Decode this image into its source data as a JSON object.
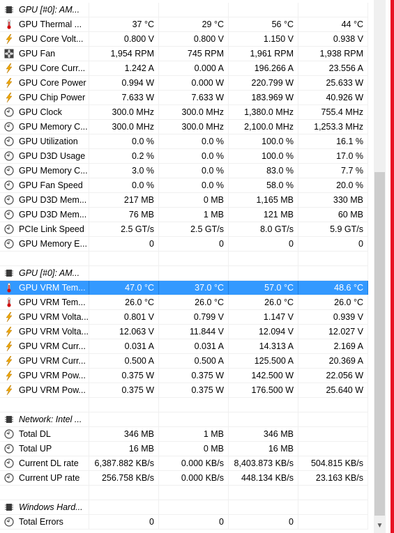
{
  "colors": {
    "selected_row": "#3399ff",
    "accent_red": "#e81123"
  },
  "rows": [
    {
      "kind": "header",
      "icon": "chip-icon",
      "label": "GPU [#0]: AM...",
      "v": [
        "",
        "",
        "",
        ""
      ]
    },
    {
      "kind": "data",
      "icon": "thermometer-icon",
      "label": "GPU Thermal ...",
      "v": [
        "37 °C",
        "29 °C",
        "56 °C",
        "44 °C"
      ]
    },
    {
      "kind": "data",
      "icon": "lightning-icon",
      "label": "GPU Core Volt...",
      "v": [
        "0.800 V",
        "0.800 V",
        "1.150 V",
        "0.938 V"
      ]
    },
    {
      "kind": "data",
      "icon": "fan-icon",
      "label": "GPU Fan",
      "v": [
        "1,954 RPM",
        "745 RPM",
        "1,961 RPM",
        "1,938 RPM"
      ]
    },
    {
      "kind": "data",
      "icon": "lightning-icon",
      "label": "GPU Core Curr...",
      "v": [
        "1.242 A",
        "0.000 A",
        "196.266 A",
        "23.556 A"
      ]
    },
    {
      "kind": "data",
      "icon": "lightning-icon",
      "label": "GPU Core Power",
      "v": [
        "0.994 W",
        "0.000 W",
        "220.799 W",
        "25.633 W"
      ]
    },
    {
      "kind": "data",
      "icon": "lightning-icon",
      "label": "GPU Chip Power",
      "v": [
        "7.633 W",
        "7.633 W",
        "183.969 W",
        "40.926 W"
      ]
    },
    {
      "kind": "data",
      "icon": "clock-icon",
      "label": "GPU Clock",
      "v": [
        "300.0 MHz",
        "300.0 MHz",
        "1,380.0 MHz",
        "755.4 MHz"
      ]
    },
    {
      "kind": "data",
      "icon": "clock-icon",
      "label": "GPU Memory C...",
      "v": [
        "300.0 MHz",
        "300.0 MHz",
        "2,100.0 MHz",
        "1,253.3 MHz"
      ]
    },
    {
      "kind": "data",
      "icon": "clock-icon",
      "label": "GPU Utilization",
      "v": [
        "0.0 %",
        "0.0 %",
        "100.0 %",
        "16.1 %"
      ]
    },
    {
      "kind": "data",
      "icon": "clock-icon",
      "label": "GPU D3D Usage",
      "v": [
        "0.2 %",
        "0.0 %",
        "100.0 %",
        "17.0 %"
      ]
    },
    {
      "kind": "data",
      "icon": "clock-icon",
      "label": "GPU Memory C...",
      "v": [
        "3.0 %",
        "0.0 %",
        "83.0 %",
        "7.7 %"
      ]
    },
    {
      "kind": "data",
      "icon": "clock-icon",
      "label": "GPU Fan Speed",
      "v": [
        "0.0 %",
        "0.0 %",
        "58.0 %",
        "20.0 %"
      ]
    },
    {
      "kind": "data",
      "icon": "clock-icon",
      "label": "GPU D3D Mem...",
      "v": [
        "217 MB",
        "0 MB",
        "1,165 MB",
        "330 MB"
      ]
    },
    {
      "kind": "data",
      "icon": "clock-icon",
      "label": "GPU D3D Mem...",
      "v": [
        "76 MB",
        "1 MB",
        "121 MB",
        "60 MB"
      ]
    },
    {
      "kind": "data",
      "icon": "clock-icon",
      "label": "PCIe Link Speed",
      "v": [
        "2.5 GT/s",
        "2.5 GT/s",
        "8.0 GT/s",
        "5.9 GT/s"
      ]
    },
    {
      "kind": "data",
      "icon": "clock-icon",
      "label": "GPU Memory E...",
      "v": [
        "0",
        "0",
        "0",
        "0"
      ]
    },
    {
      "kind": "blank",
      "icon": "",
      "label": "",
      "v": [
        "",
        "",
        "",
        ""
      ]
    },
    {
      "kind": "header",
      "icon": "chip-icon",
      "label": "GPU [#0]: AM...",
      "v": [
        "",
        "",
        "",
        ""
      ]
    },
    {
      "kind": "data",
      "icon": "thermometer-icon",
      "label": "GPU VRM Tem...",
      "v": [
        "47.0 °C",
        "37.0 °C",
        "57.0 °C",
        "48.6 °C"
      ],
      "selected": true
    },
    {
      "kind": "data",
      "icon": "thermometer-icon",
      "label": "GPU VRM Tem...",
      "v": [
        "26.0 °C",
        "26.0 °C",
        "26.0 °C",
        "26.0 °C"
      ]
    },
    {
      "kind": "data",
      "icon": "lightning-icon",
      "label": "GPU VRM Volta...",
      "v": [
        "0.801 V",
        "0.799 V",
        "1.147 V",
        "0.939 V"
      ]
    },
    {
      "kind": "data",
      "icon": "lightning-icon",
      "label": "GPU VRM Volta...",
      "v": [
        "12.063 V",
        "11.844 V",
        "12.094 V",
        "12.027 V"
      ]
    },
    {
      "kind": "data",
      "icon": "lightning-icon",
      "label": "GPU VRM Curr...",
      "v": [
        "0.031 A",
        "0.031 A",
        "14.313 A",
        "2.169 A"
      ]
    },
    {
      "kind": "data",
      "icon": "lightning-icon",
      "label": "GPU VRM Curr...",
      "v": [
        "0.500 A",
        "0.500 A",
        "125.500 A",
        "20.369 A"
      ]
    },
    {
      "kind": "data",
      "icon": "lightning-icon",
      "label": "GPU VRM Pow...",
      "v": [
        "0.375 W",
        "0.375 W",
        "142.500 W",
        "22.056 W"
      ]
    },
    {
      "kind": "data",
      "icon": "lightning-icon",
      "label": "GPU VRM Pow...",
      "v": [
        "0.375 W",
        "0.375 W",
        "176.500 W",
        "25.640 W"
      ]
    },
    {
      "kind": "blank",
      "icon": "",
      "label": "",
      "v": [
        "",
        "",
        "",
        ""
      ]
    },
    {
      "kind": "header",
      "icon": "chip-icon",
      "label": "Network: Intel ...",
      "v": [
        "",
        "",
        "",
        ""
      ]
    },
    {
      "kind": "data",
      "icon": "clock-icon",
      "label": "Total DL",
      "v": [
        "346 MB",
        "1 MB",
        "346 MB",
        ""
      ]
    },
    {
      "kind": "data",
      "icon": "clock-icon",
      "label": "Total UP",
      "v": [
        "16 MB",
        "0 MB",
        "16 MB",
        ""
      ]
    },
    {
      "kind": "data",
      "icon": "clock-icon",
      "label": "Current DL rate",
      "v": [
        "6,387.882 KB/s",
        "0.000 KB/s",
        "8,403.873 KB/s",
        "504.815 KB/s"
      ]
    },
    {
      "kind": "data",
      "icon": "clock-icon",
      "label": "Current UP rate",
      "v": [
        "256.758 KB/s",
        "0.000 KB/s",
        "448.134 KB/s",
        "23.163 KB/s"
      ]
    },
    {
      "kind": "blank",
      "icon": "",
      "label": "",
      "v": [
        "",
        "",
        "",
        ""
      ]
    },
    {
      "kind": "header",
      "icon": "chip-icon",
      "label": "Windows Hard...",
      "v": [
        "",
        "",
        "",
        ""
      ]
    },
    {
      "kind": "data",
      "icon": "clock-icon",
      "label": "Total Errors",
      "v": [
        "0",
        "0",
        "0",
        ""
      ]
    }
  ]
}
